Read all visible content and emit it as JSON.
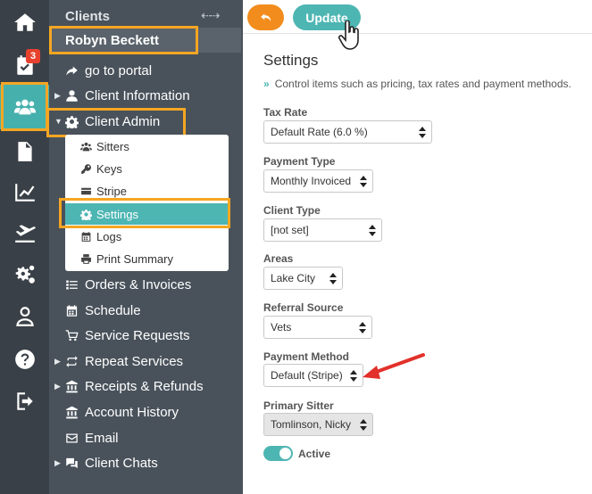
{
  "rail": {
    "badge_count": "3",
    "items": [
      {
        "name": "home-icon"
      },
      {
        "name": "calendar-check-icon"
      },
      {
        "name": "users-icon"
      },
      {
        "name": "document-icon"
      },
      {
        "name": "chart-icon"
      },
      {
        "name": "plane-icon"
      },
      {
        "name": "gears-icon"
      },
      {
        "name": "user-icon"
      },
      {
        "name": "help-icon"
      },
      {
        "name": "logout-icon"
      }
    ]
  },
  "sidebar": {
    "title": "Clients",
    "client_name": "Robyn Beckett",
    "items": [
      {
        "label": "go to portal",
        "icon": "share-arrow-icon"
      },
      {
        "label": "Client Information",
        "icon": "user-icon"
      },
      {
        "label": "Client Admin",
        "icon": "gear-icon"
      },
      {
        "label": "Orders & Invoices",
        "icon": "list-icon"
      },
      {
        "label": "Schedule",
        "icon": "calendar-icon"
      },
      {
        "label": "Service Requests",
        "icon": "cart-icon"
      },
      {
        "label": "Repeat Services",
        "icon": "repeat-icon"
      },
      {
        "label": "Receipts & Refunds",
        "icon": "bank-icon"
      },
      {
        "label": "Account History",
        "icon": "bank-icon"
      },
      {
        "label": "Email",
        "icon": "envelope-icon"
      },
      {
        "label": "Client Chats",
        "icon": "chat-icon"
      }
    ],
    "admin_sub": [
      {
        "label": "Sitters",
        "icon": "group-icon"
      },
      {
        "label": "Keys",
        "icon": "key-icon"
      },
      {
        "label": "Stripe",
        "icon": "credit-card-icon"
      },
      {
        "label": "Settings",
        "icon": "gear-icon"
      },
      {
        "label": "Logs",
        "icon": "calendar-icon"
      },
      {
        "label": "Print Summary",
        "icon": "print-icon"
      }
    ]
  },
  "toolbar": {
    "update_label": "Update"
  },
  "settings": {
    "heading": "Settings",
    "description": "Control items such as pricing, tax rates and payment methods.",
    "fields": [
      {
        "label": "Tax Rate",
        "value": "Default Rate (6.0 %)"
      },
      {
        "label": "Payment Type",
        "value": "Monthly Invoiced"
      },
      {
        "label": "Client Type",
        "value": "[not set]"
      },
      {
        "label": "Areas",
        "value": "Lake City"
      },
      {
        "label": "Referral Source",
        "value": "Vets"
      },
      {
        "label": "Payment Method",
        "value": "Default (Stripe)"
      },
      {
        "label": "Primary Sitter",
        "value": "Tomlinson, Nicky"
      }
    ],
    "active_label": "Active",
    "active_on": true
  },
  "colors": {
    "accent": "#4db6b3",
    "highlight": "#f5a623",
    "back_button": "#f28c1c",
    "annotation_arrow": "#e2302a",
    "badge": "#e8422e"
  }
}
